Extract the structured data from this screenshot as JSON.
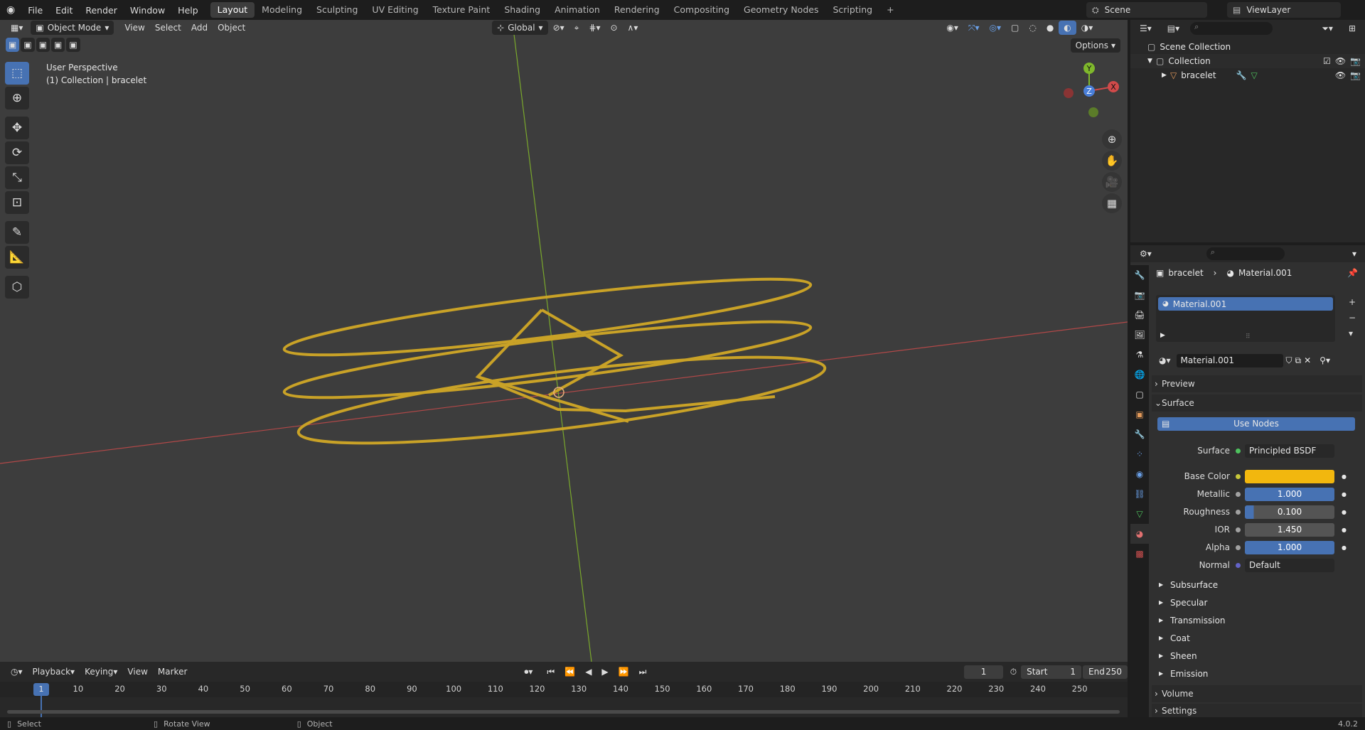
{
  "topbar": {
    "menu": [
      "File",
      "Edit",
      "Render",
      "Window",
      "Help"
    ],
    "workspaces": [
      "Layout",
      "Modeling",
      "Sculpting",
      "UV Editing",
      "Texture Paint",
      "Shading",
      "Animation",
      "Rendering",
      "Compositing",
      "Geometry Nodes",
      "Scripting"
    ],
    "active_workspace": "Layout",
    "add_workspace": "+",
    "scene": "Scene",
    "view_layer": "ViewLayer"
  },
  "viewport": {
    "mode": "Object Mode",
    "menus": [
      "View",
      "Select",
      "Add",
      "Object"
    ],
    "orientation": "Global",
    "options_label": "Options",
    "overlay_title": "User Perspective",
    "overlay_sub": "(1) Collection | bracelet",
    "gizmo": {
      "y": "Y",
      "z": "Z",
      "x": "X"
    },
    "colors": {
      "bg": "#3d3d3d",
      "x_axis": "#c74a4a",
      "y_axis": "#7fb82c",
      "gold": "#c9a227"
    }
  },
  "outliner": {
    "search_placeholder": "",
    "items": [
      {
        "label": "Scene Collection"
      },
      {
        "label": "Collection"
      },
      {
        "label": "bracelet"
      }
    ]
  },
  "properties": {
    "breadcrumb_object": "bracelet",
    "breadcrumb_material": "Material.001",
    "slot_name": "Material.001",
    "material_name": "Material.001",
    "sections": {
      "preview": "Preview",
      "surface": "Surface",
      "use_nodes": "Use Nodes",
      "subsections": [
        "Subsurface",
        "Specular",
        "Transmission",
        "Coat",
        "Sheen",
        "Emission"
      ],
      "volume": "Volume",
      "settings": "Settings"
    },
    "fields": [
      {
        "label": "Surface",
        "value": "Principled BSDF"
      },
      {
        "label": "Base Color",
        "value": ""
      },
      {
        "label": "Metallic",
        "value": "1.000",
        "fill": 1.0
      },
      {
        "label": "Roughness",
        "value": "0.100",
        "fill": 0.1
      },
      {
        "label": "IOR",
        "value": "1.450",
        "fill": 0
      },
      {
        "label": "Alpha",
        "value": "1.000",
        "fill": 1.0
      },
      {
        "label": "Normal",
        "value": "Default"
      }
    ],
    "base_color": "#f2b70e",
    "version": "4.0.2"
  },
  "timeline": {
    "menus": [
      "Playback",
      "Keying",
      "View",
      "Marker"
    ],
    "current_frame": "1",
    "start_label": "Start",
    "start": "1",
    "end_label": "End",
    "end": "250",
    "ticks": [
      "1",
      "10",
      "20",
      "30",
      "40",
      "50",
      "60",
      "70",
      "80",
      "90",
      "100",
      "110",
      "120",
      "130",
      "140",
      "150",
      "160",
      "170",
      "180",
      "190",
      "200",
      "210",
      "220",
      "230",
      "240",
      "250"
    ]
  },
  "statusbar": {
    "select": "Select",
    "rotate": "Rotate View",
    "object": "Object"
  }
}
